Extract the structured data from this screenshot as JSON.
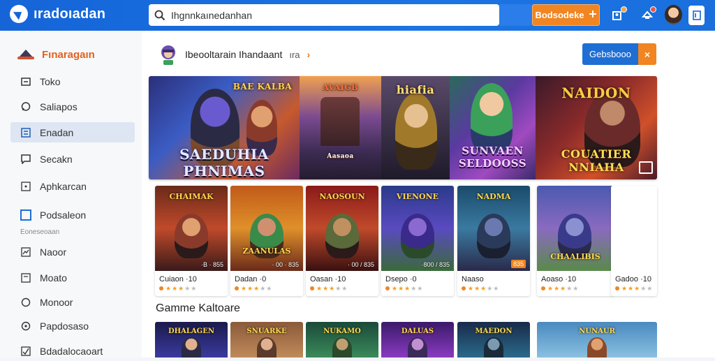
{
  "app": {
    "logo_text": "ıradoıadan"
  },
  "header": {
    "search_value": "Ihgnnkaınedanhan",
    "cta_label": "Bodsodeke",
    "cta_icon": "plus-square-icon",
    "icons": [
      "user-upload-icon",
      "notification-icon",
      "avatar",
      "app-square-icon"
    ],
    "accent": "#1565d8",
    "orange": "#f08522"
  },
  "sidebar": {
    "title": "Fınaragaın",
    "items": [
      {
        "label": "Toko",
        "icon": "square-minus-icon",
        "active": false
      },
      {
        "label": "Saliapos",
        "icon": "chat-bubble-icon",
        "active": false
      },
      {
        "label": "Enadan",
        "icon": "list-icon",
        "active": true
      },
      {
        "label": "Secakn",
        "icon": "message-icon",
        "active": false
      },
      {
        "label": "Aphkarcan",
        "icon": "square-dot-icon",
        "active": false
      },
      {
        "label": "Podsaleon",
        "icon": "square-icon",
        "active": false
      }
    ],
    "section_label": "Eoneseoaan",
    "items2": [
      {
        "label": "Naoor",
        "icon": "chart-icon"
      },
      {
        "label": "Moato",
        "icon": "document-icon"
      },
      {
        "label": "Monoor",
        "icon": "circle-icon"
      },
      {
        "label": "Papdosaso",
        "icon": "clock-icon"
      },
      {
        "label": "Bdadalocaoart",
        "icon": "check-square-icon"
      }
    ]
  },
  "main": {
    "crumb_title": "Ibeooltarain Ihandaant",
    "crumb_small": "ıra",
    "crumb_chevron": "›",
    "blue_button": "Gebsbooo",
    "blue_button_close": "×",
    "banner": [
      {
        "title": "SAEDUHIA PHNIMAS",
        "top_text": "BAE KALBA"
      },
      {
        "title": "Aasaoa",
        "top_text": "AVAIGB"
      },
      {
        "title": "",
        "top_text": "hiafia"
      },
      {
        "title": "SUNVAEN SELDOOSS",
        "top_text": ""
      },
      {
        "title": "COUATIER NNIAHA",
        "top_text": "NAIDON"
      }
    ],
    "cards": [
      {
        "title": "CHAIMAK",
        "name": "Cuiaon ·10",
        "price": "·B · 855",
        "price_orange": false
      },
      {
        "title": "ZAANULAS",
        "name": "Dadan ·0",
        "price": "· 00 · 835",
        "price_orange": false
      },
      {
        "title": "NAOSOUN",
        "name": "Oasan ·10",
        "price": "· 00 / 835",
        "price_orange": false
      },
      {
        "title": "VIENONE",
        "name": "Dsepo ·0",
        "price": "·800 / 835",
        "price_orange": false
      },
      {
        "title": "NADMA",
        "name": "Naaso",
        "price": "835",
        "price_orange": true
      },
      {
        "title": "CHAALIBIS",
        "name": "Aoaso ·10",
        "price": "",
        "price_orange": false
      },
      {
        "title": "",
        "name": "Gadoo ·10",
        "price": "",
        "price_orange": false
      }
    ],
    "section_title": "Gamme Kaltoare",
    "thumbs": [
      "DHALAGEN",
      "SNUARKE",
      "NUKAMO",
      "DALUAS",
      "MAEDON",
      "NUNAUR"
    ]
  }
}
